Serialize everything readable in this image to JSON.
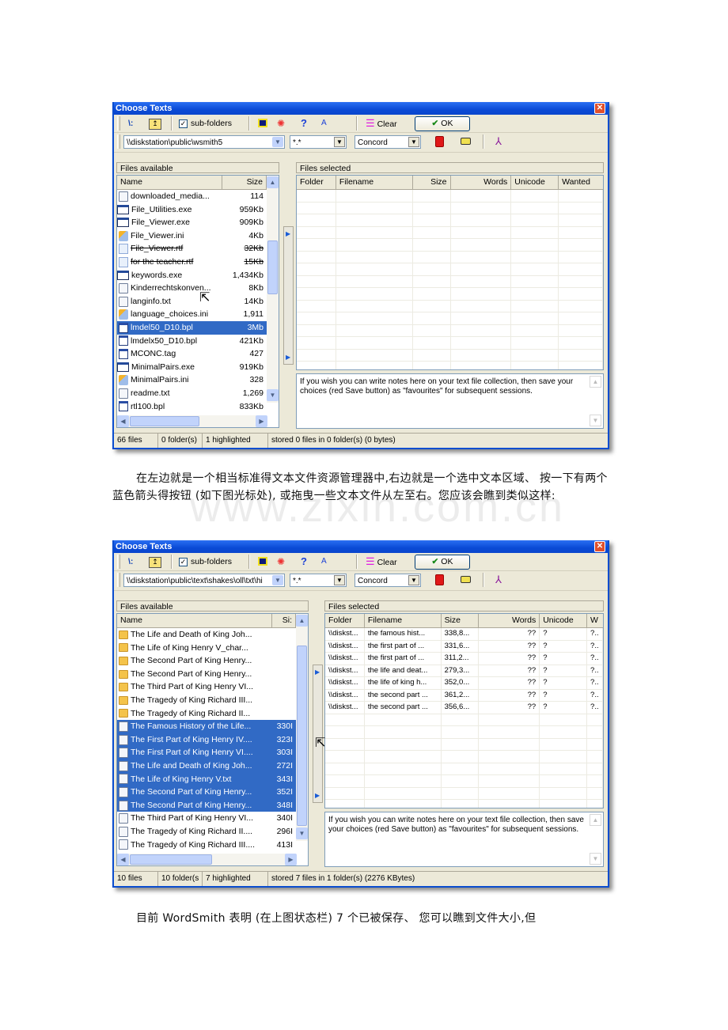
{
  "windows": [
    {
      "title": "Choose Texts",
      "toolbar": {
        "subfolders_label": "sub-folders",
        "subfolders_checked": true,
        "clear_label": "Clear",
        "ok_label": "OK"
      },
      "path": "\\\\diskstation\\public\\wsmith5",
      "filter": "*.*",
      "tool": "Concord",
      "left_panel_title": "Files available",
      "left_columns": [
        "Name",
        "Size"
      ],
      "files": [
        {
          "icon": "txt",
          "name": "downloaded_media...",
          "size": "114"
        },
        {
          "icon": "exe",
          "name": "File_Utilities.exe",
          "size": "959Kb"
        },
        {
          "icon": "exe",
          "name": "File_Viewer.exe",
          "size": "909Kb"
        },
        {
          "icon": "ini",
          "name": "File_Viewer.ini",
          "size": "4Kb"
        },
        {
          "icon": "rtf",
          "name": "File_Viewer.rtf",
          "size": "32Kb",
          "strike": true
        },
        {
          "icon": "rtf",
          "name": "for the teacher.rtf",
          "size": "15Kb",
          "strike": true
        },
        {
          "icon": "exe",
          "name": "keywords.exe",
          "size": "1,434Kb"
        },
        {
          "icon": "txt",
          "name": "Kinderrechtskonven...",
          "size": "8Kb"
        },
        {
          "icon": "txt",
          "name": "langinfo.txt",
          "size": "14Kb"
        },
        {
          "icon": "ini",
          "name": "language_choices.ini",
          "size": "1,911"
        },
        {
          "icon": "bpl",
          "name": "lmdel50_D10.bpl",
          "size": "3Mb",
          "selected": true
        },
        {
          "icon": "bpl",
          "name": "lmdelx50_D10.bpl",
          "size": "421Kb"
        },
        {
          "icon": "bpl",
          "name": "MCONC.tag",
          "size": "427"
        },
        {
          "icon": "exe",
          "name": "MinimalPairs.exe",
          "size": "919Kb"
        },
        {
          "icon": "ini",
          "name": "MinimalPairs.ini",
          "size": "328"
        },
        {
          "icon": "txt",
          "name": "readme.txt",
          "size": "1,269"
        },
        {
          "icon": "bpl",
          "name": "rtl100.bpl",
          "size": "833Kb"
        }
      ],
      "right_panel_title": "Files selected",
      "right_columns": [
        "Folder",
        "Filename",
        "Size",
        "Words",
        "Unicode",
        "Wanted"
      ],
      "selected_rows": [],
      "notes": "If you wish you can write notes here on your text file collection, then save your choices (red Save button) as \"favourites\" for subsequent sessions.",
      "status": [
        "66 files",
        "0 folder(s)",
        "1 highlighted",
        "stored 0 files in 0 folder(s) (0 bytes)"
      ]
    },
    {
      "title": "Choose Texts",
      "toolbar": {
        "subfolders_label": "sub-folders",
        "subfolders_checked": true,
        "clear_label": "Clear",
        "ok_label": "OK"
      },
      "path": "\\\\diskstation\\public\\text\\shakes\\oll\\txt\\hi",
      "filter": "*.*",
      "tool": "Concord",
      "left_panel_title": "Files available",
      "left_columns": [
        "Name",
        "Si:"
      ],
      "files": [
        {
          "icon": "folder",
          "name": "The Life and Death of King Joh...",
          "size": ""
        },
        {
          "icon": "folder",
          "name": "The Life of King Henry V_char...",
          "size": ""
        },
        {
          "icon": "folder",
          "name": "The Second Part of King Henry...",
          "size": ""
        },
        {
          "icon": "folder",
          "name": "The Second Part of King Henry...",
          "size": ""
        },
        {
          "icon": "folder",
          "name": "The Third Part of King Henry VI...",
          "size": ""
        },
        {
          "icon": "folder",
          "name": "The Tragedy of King Richard III...",
          "size": ""
        },
        {
          "icon": "folder",
          "name": "The Tragedy of King Richard II...",
          "size": ""
        },
        {
          "icon": "txt",
          "name": "The Famous History of the Life...",
          "size": "330I",
          "selected": true
        },
        {
          "icon": "txt",
          "name": "The First Part of King Henry IV....",
          "size": "323I",
          "selected": true
        },
        {
          "icon": "txt",
          "name": "The First Part of King Henry VI....",
          "size": "303I",
          "selected": true
        },
        {
          "icon": "txt",
          "name": "The Life and Death of King Joh...",
          "size": "272I",
          "selected": true
        },
        {
          "icon": "txt",
          "name": "The Life of King Henry V.txt",
          "size": "343I",
          "selected": true
        },
        {
          "icon": "txt",
          "name": "The Second Part of King Henry...",
          "size": "352I",
          "selected": true
        },
        {
          "icon": "txt",
          "name": "The Second Part of King Henry...",
          "size": "348I",
          "selected": true
        },
        {
          "icon": "txt",
          "name": "The Third Part of King Henry VI...",
          "size": "340I"
        },
        {
          "icon": "txt",
          "name": "The Tragedy of King Richard II....",
          "size": "296I"
        },
        {
          "icon": "txt",
          "name": "The Tragedy of King Richard III....",
          "size": "413I"
        }
      ],
      "right_panel_title": "Files selected",
      "right_columns": [
        "Folder",
        "Filename",
        "Size",
        "Words",
        "Unicode",
        "W"
      ],
      "selected_rows": [
        [
          "\\\\diskst...",
          "the famous hist...",
          "338,8...",
          "??",
          "?",
          "?.."
        ],
        [
          "\\\\diskst...",
          "the first part of ...",
          "331,6...",
          "??",
          "?",
          "?.."
        ],
        [
          "\\\\diskst...",
          "the first part of ...",
          "311,2...",
          "??",
          "?",
          "?.."
        ],
        [
          "\\\\diskst...",
          "the life and deat...",
          "279,3...",
          "??",
          "?",
          "?.."
        ],
        [
          "\\\\diskst...",
          "the life of king h...",
          "352,0...",
          "??",
          "?",
          "?.."
        ],
        [
          "\\\\diskst...",
          "the second part ...",
          "361,2...",
          "??",
          "?",
          "?.."
        ],
        [
          "\\\\diskst...",
          "the second part ...",
          "356,6...",
          "??",
          "?",
          "?.."
        ]
      ],
      "notes": "If you wish you can write notes here on your text file collection, then save your choices (red Save button) as \"favourites\" for subsequent sessions.",
      "status": [
        "10 files",
        "10 folder(s",
        "7 highlighted",
        "stored 7 files in 1 folder(s) (2276 KBytes)"
      ]
    }
  ],
  "paragraphs": {
    "p1": "在左边就是一个相当标准得文本文件资源管理器中,右边就是一个选中文本区域、 按一下有两个蓝色箭头得按钮 (如下图光标处), 或拖曳一些文本文件从左至右。您应该会瞧到类似这样:",
    "p2": "目前 WordSmith 表明 (在上图状态栏) 7 个已被保存、 您可以瞧到文件大小,但"
  },
  "watermark": "www.zixin.com.cn"
}
